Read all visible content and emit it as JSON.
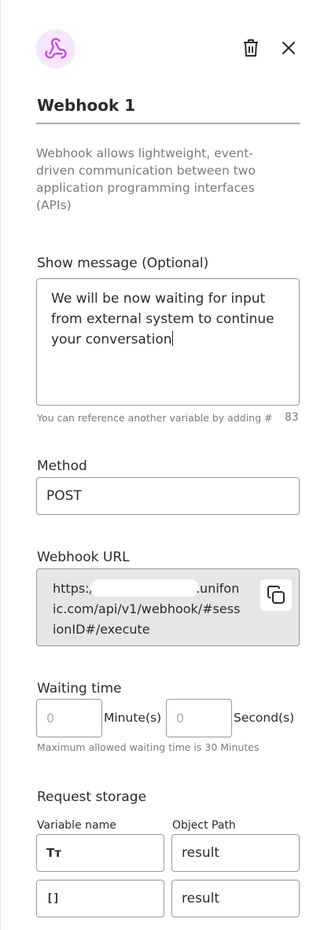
{
  "panel": {
    "title": "Webhook 1",
    "description": "Webhook allows lightweight, event-driven communication between two application programming interfaces (APIs)",
    "icons": {
      "header": "webhook-icon",
      "delete": "trash-icon",
      "close": "close-icon"
    },
    "accent_color": "#c64fd8",
    "icon_bg_color": "#f6e6fb"
  },
  "show_message": {
    "label": "Show message (Optional)",
    "value": "We will be now waiting for input from external system to continue your conversation",
    "hint": "You can reference another variable by adding #",
    "char_count": "83"
  },
  "method": {
    "label": "Method",
    "value": "POST"
  },
  "webhook_url": {
    "label": "Webhook URL",
    "prefix": "https:/",
    "suffix": ".unifonic.com/api/v1/webhook/#sessionID#/execute",
    "copy_icon": "copy-icon"
  },
  "waiting_time": {
    "label": "Waiting time",
    "minutes_placeholder": "0",
    "minutes_unit": "Minute(s)",
    "seconds_placeholder": "0",
    "seconds_unit": "Second(s)",
    "hint": "Maximum allowed waiting time is 30 Minutes"
  },
  "request_storage": {
    "label": "Request storage",
    "variable_name_header": "Variable name",
    "object_path_header": "Object Path",
    "rows": [
      {
        "type_icon": "Tт",
        "type_icon_name": "text-type-icon",
        "object_path": "result"
      },
      {
        "type_icon": "[]",
        "type_icon_name": "array-type-icon",
        "object_path": "result"
      }
    ]
  }
}
